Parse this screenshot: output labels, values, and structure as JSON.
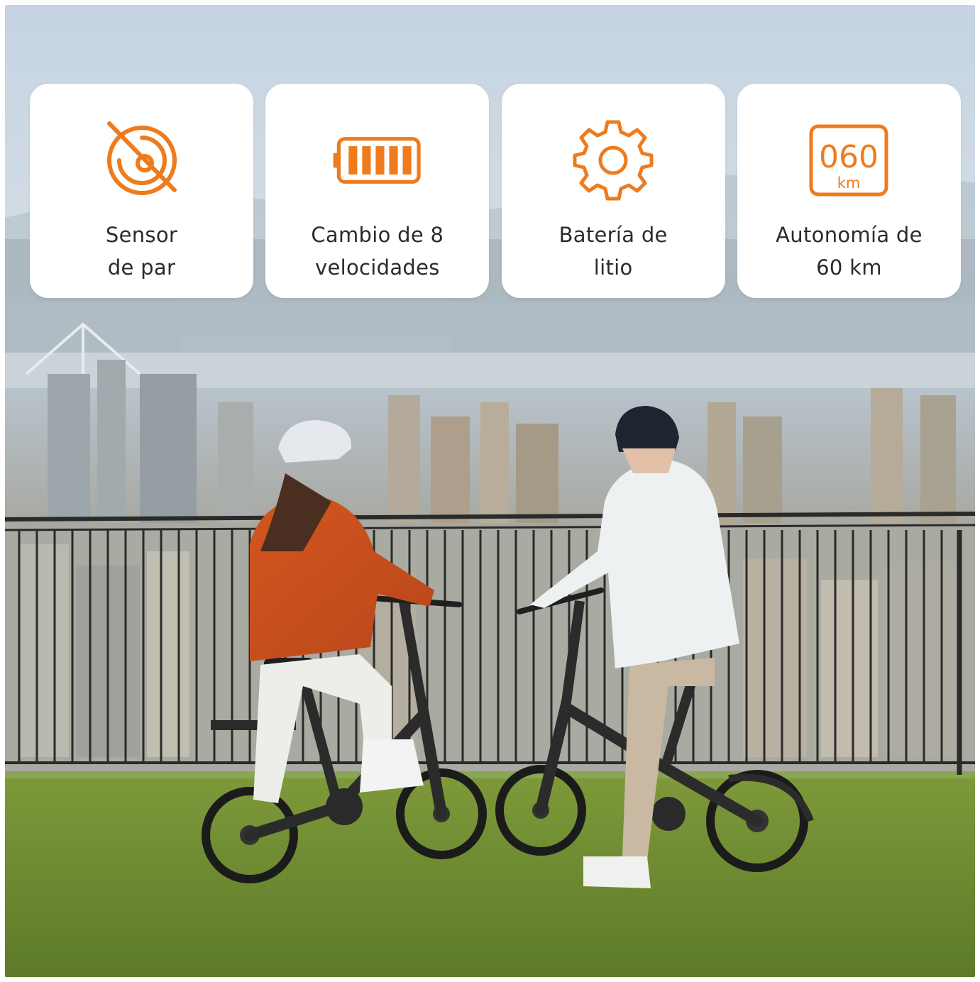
{
  "colors": {
    "accent": "#EE7B1C",
    "card_bg": "#FFFFFF",
    "text": "#2B2B2B"
  },
  "features": [
    {
      "icon": "torque-sensor-icon",
      "label": "Sensor\nde par"
    },
    {
      "icon": "battery-icon",
      "label": "Cambio de 8\nvelocidades"
    },
    {
      "icon": "gear-icon",
      "label": "Batería de\nlitio"
    },
    {
      "icon": "odometer-icon",
      "label": "Autonomía de\n60 km",
      "icon_text": {
        "value": "060",
        "unit": "km"
      }
    }
  ]
}
